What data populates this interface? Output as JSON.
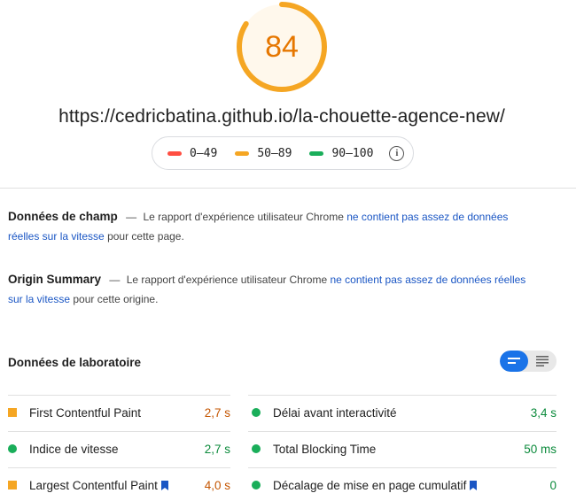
{
  "score": {
    "value": "84",
    "fraction": 0.84,
    "color": "#f5a623"
  },
  "url": "https://cedricbatina.github.io/la-chouette-agence-new/",
  "legend": {
    "items": [
      {
        "label": "0–49",
        "color": "#ff4e42"
      },
      {
        "label": "50–89",
        "color": "#f5a623"
      },
      {
        "label": "90–100",
        "color": "#1aae5a"
      }
    ],
    "info_icon": "info-icon"
  },
  "field_data": {
    "title": "Données de champ",
    "dash": "—",
    "prefix": "Le rapport d'expérience utilisateur Chrome",
    "link": "ne contient pas assez de données réelles sur la vitesse",
    "suffix": "pour cette page."
  },
  "origin_summary": {
    "title": "Origin Summary",
    "dash": "—",
    "prefix": "Le rapport d'expérience utilisateur Chrome",
    "link": "ne contient pas assez de données réelles sur la vitesse",
    "suffix": "pour cette origine."
  },
  "lab": {
    "title": "Données de laboratoire",
    "toggle": [
      "summary-view-icon",
      "detail-view-icon"
    ],
    "metrics_left": [
      {
        "label": "First Contentful Paint",
        "value": "2,7 s",
        "status": "average",
        "bookmark": false
      },
      {
        "label": "Indice de vitesse",
        "value": "2,7 s",
        "status": "good",
        "bookmark": false
      },
      {
        "label": "Largest Contentful Paint",
        "value": "4,0 s",
        "status": "average",
        "bookmark": true
      }
    ],
    "metrics_right": [
      {
        "label": "Délai avant interactivité",
        "value": "3,4 s",
        "status": "good",
        "bookmark": false
      },
      {
        "label": "Total Blocking Time",
        "value": "50 ms",
        "status": "good",
        "bookmark": false
      },
      {
        "label": "Décalage de mise en page cumulatif",
        "value": "0",
        "status": "good",
        "bookmark": true
      }
    ]
  }
}
